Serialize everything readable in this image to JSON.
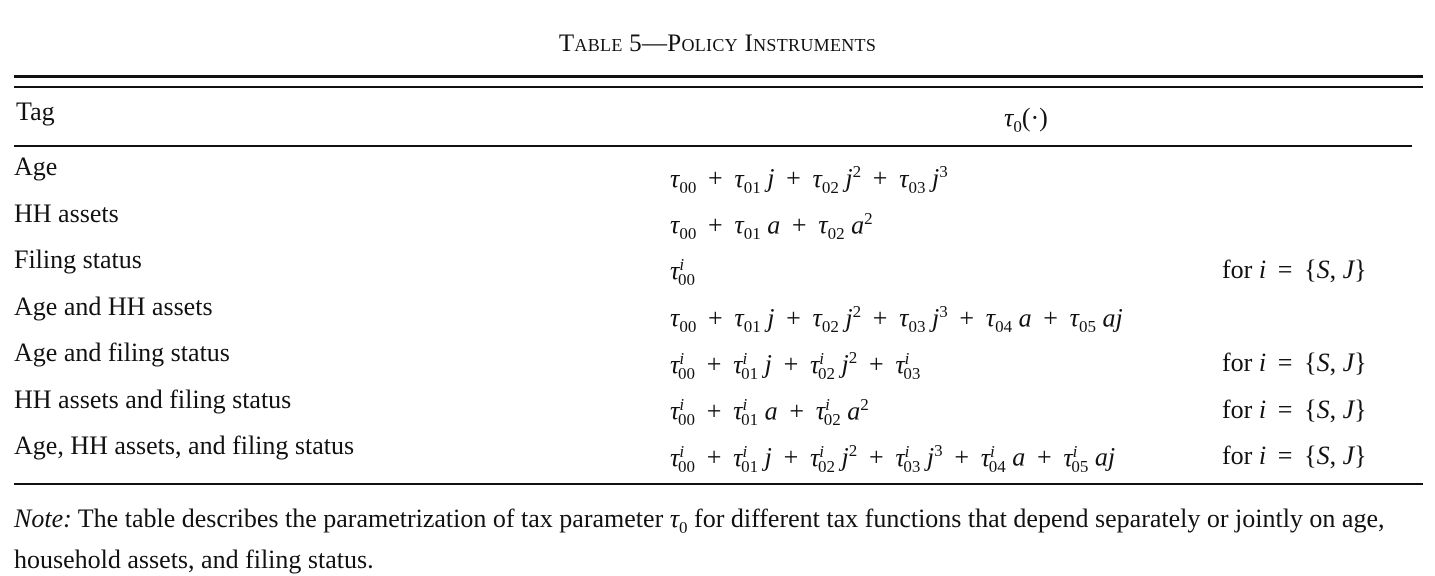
{
  "table": {
    "title": "Table 5—Policy Instruments",
    "header": {
      "tag": "Tag",
      "formula_symbol": "τ",
      "formula_subscript": "0",
      "formula_arg": "(·)"
    },
    "rows": [
      {
        "tag": "Age",
        "formula": "τ00 + τ01 j + τ02 j^2 + τ03 j^3",
        "condition": ""
      },
      {
        "tag": "HH assets",
        "formula": "τ00 + τ01 a + τ02 a^2",
        "condition": ""
      },
      {
        "tag": "Filing status",
        "formula": "τ^i_00",
        "condition": "for i = {S, J}"
      },
      {
        "tag": "Age and HH assets",
        "formula": "τ00 + τ01 j + τ02 j^2 + τ03 j^3 + τ04 a + τ05 aj",
        "condition": ""
      },
      {
        "tag": "Age and filing status",
        "formula": "τ^i_00 + τ^i_01 j + τ^i_02 j^2 + τ^i_03",
        "condition": "for i = {S, J}"
      },
      {
        "tag": "HH assets and filing status",
        "formula": "τ^i_00 + τ^i_01 a + τ^i_02 a^2",
        "condition": "for i = {S, J}"
      },
      {
        "tag": "Age, HH assets, and filing status",
        "formula": "τ^i_00 + τ^i_01 j + τ^i_02 j^2 + τ^i_03 j^3 + τ^i_04 a + τ^i_05 aj",
        "condition": "for i = {S, J}"
      }
    ],
    "note": {
      "lead": "Note:",
      "text_before": "The table describes the parametrization of tax parameter",
      "symbol": "τ",
      "symbol_subscript": "0",
      "text_after": "for different tax functions that depend separately or jointly on age, household assets, and filing status."
    }
  }
}
